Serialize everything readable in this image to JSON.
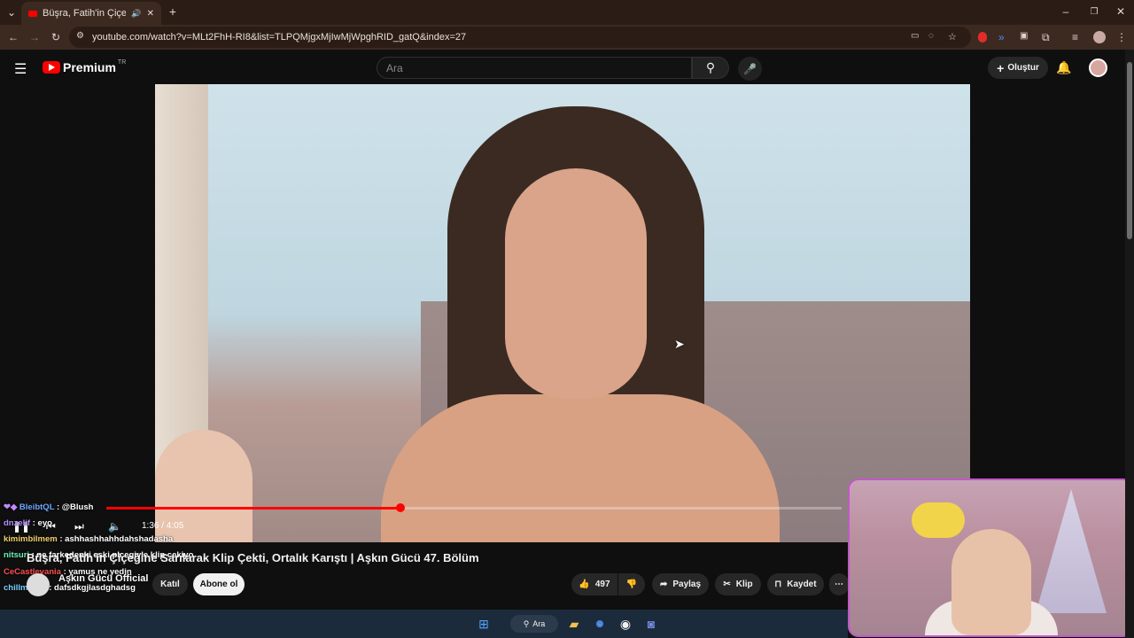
{
  "browser": {
    "tab_title": "Büşra, Fatih'in Çiçeğine Sarı",
    "url": "youtube.com/watch?v=MLt2FhH-RI8&list=TLPQMjgxMjIwMjWpghRID_gatQ&index=27"
  },
  "header": {
    "logo_text": "Premium",
    "logo_country": "TR",
    "search_placeholder": "Ara",
    "create_label": "Oluştur"
  },
  "player": {
    "time": "1:36 / 4:05",
    "progress": 0.4
  },
  "chat": [
    {
      "user": "BleibtQL",
      "text": ": @Blush",
      "color": "#6ea8ff"
    },
    {
      "user": "dnzelif",
      "text": ": eyo",
      "color": "#b58cff"
    },
    {
      "user": "kimimbilmem",
      "text": ": ashhashhahhdahshadasha",
      "color": "#f2d06b"
    },
    {
      "user": "nitsuri",
      "text": ": ne farkedenki eski plcegiyle klip cekiyo",
      "color": "#6ef0b8"
    },
    {
      "user": "CeCastlevania",
      "text": ": yamuş ne yedin",
      "color": "#ff4d4d"
    },
    {
      "user": "chillmaxes",
      "text": ": dafsdkgjlasdghadsg",
      "color": "#7ad0ff"
    }
  ],
  "video": {
    "title": "Büşra, Fatih'in Çiçeğine Sarılarak Klip Çekti, Ortalık Karıştı | Aşkın Gücü 47. Bölüm",
    "channel": "Aşkın Gücü Official",
    "join_label": "Katıl",
    "subscribe_label": "Abone ol",
    "likes": "497",
    "share_label": "Paylaş",
    "clip_label": "Klip",
    "save_label": "Kaydet"
  },
  "taskbar": {
    "search_label": "Ara"
  }
}
